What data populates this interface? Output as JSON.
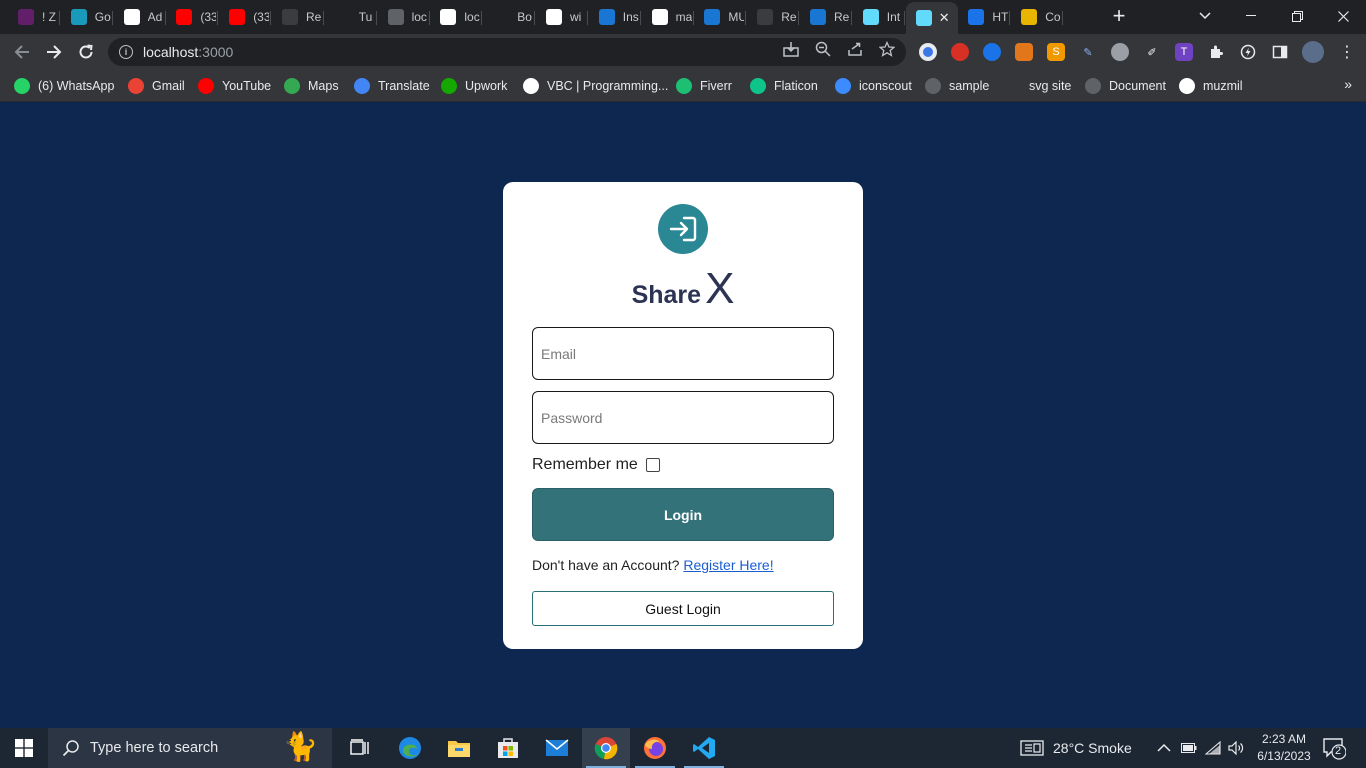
{
  "browser": {
    "tabs": [
      {
        "title": "! Z",
        "icon": "slack-icon",
        "color": "#611f69"
      },
      {
        "title": "Go",
        "icon": "go-icon",
        "color": "#1a9abb"
      },
      {
        "title": "Ad",
        "icon": "google-ads-icon",
        "color": "#ffffff"
      },
      {
        "title": "(33",
        "icon": "youtube-icon",
        "color": "#ff0000"
      },
      {
        "title": "(33",
        "icon": "youtube-icon",
        "color": "#ff0000"
      },
      {
        "title": "Re",
        "icon": "react-icon",
        "color": "#3a3c40"
      },
      {
        "title": "Tu",
        "icon": "dots-icon",
        "color": "#202124"
      },
      {
        "title": "loc",
        "icon": "react-icon",
        "color": "#5f6368"
      },
      {
        "title": "loc",
        "icon": "google-icon",
        "color": "#ffffff"
      },
      {
        "title": "Bo",
        "icon": "mdb-icon",
        "color": "#202124"
      },
      {
        "title": "wi",
        "icon": "github-icon",
        "color": "#ffffff"
      },
      {
        "title": "Ins",
        "icon": "mui-icon",
        "color": "#1976d2"
      },
      {
        "title": "ma",
        "icon": "github-icon",
        "color": "#ffffff"
      },
      {
        "title": "MU",
        "icon": "mui-icon",
        "color": "#1976d2"
      },
      {
        "title": "Re",
        "icon": "react-icon",
        "color": "#3a3c40"
      },
      {
        "title": "Re",
        "icon": "mui-icon",
        "color": "#1976d2"
      },
      {
        "title": "Int",
        "icon": "react-icon",
        "color": "#61dafb"
      },
      {
        "title": "",
        "icon": "react-icon",
        "color": "#61dafb"
      },
      {
        "title": "HT",
        "icon": "html-icon",
        "color": "#1a73e8"
      },
      {
        "title": "Co",
        "icon": "co-icon",
        "color": "#e8b600"
      }
    ],
    "url_host": "localhost",
    "url_port": ":3000",
    "bookmarks": [
      {
        "label": "(6) WhatsApp",
        "icon": "whatsapp-icon",
        "color": "#25d366"
      },
      {
        "label": "Gmail",
        "icon": "gmail-icon",
        "color": "#ea4335"
      },
      {
        "label": "YouTube",
        "icon": "youtube-icon",
        "color": "#ff0000"
      },
      {
        "label": "Maps",
        "icon": "maps-icon",
        "color": "#34a853"
      },
      {
        "label": "Translate",
        "icon": "translate-icon",
        "color": "#4285f4"
      },
      {
        "label": "Upwork",
        "icon": "upwork-icon",
        "color": "#14a800"
      },
      {
        "label": "VBC | Programming...",
        "icon": "vbc-icon",
        "color": "#ffffff"
      },
      {
        "label": "Fiverr",
        "icon": "fiverr-icon",
        "color": "#1dbf73"
      },
      {
        "label": "Flaticon",
        "icon": "flaticon-icon",
        "color": "#0fc489"
      },
      {
        "label": "iconscout",
        "icon": "iconscout-icon",
        "color": "#3c8bff"
      },
      {
        "label": "sample",
        "icon": "globe-icon",
        "color": "#5f6368"
      },
      {
        "label": "svg site",
        "icon": "svg-icon",
        "color": "#35363a"
      },
      {
        "label": "Document",
        "icon": "globe-icon",
        "color": "#5f6368"
      },
      {
        "label": "muzmil",
        "icon": "github-icon",
        "color": "#ffffff"
      }
    ]
  },
  "login": {
    "brand_word": "Share",
    "brand_letter": "X",
    "email_placeholder": "Email",
    "password_placeholder": "Password",
    "remember_label": "Remember me",
    "login_label": "Login",
    "register_prompt": "Don't have an Account?",
    "register_link": "Register Here!",
    "guest_label": "Guest Login"
  },
  "taskbar": {
    "search_placeholder": "Type here to search",
    "weather": "28°C  Smoke",
    "time": "2:23 AM",
    "date": "6/13/2023",
    "notification_count": "2"
  },
  "colors": {
    "page_bg": "#0e2750",
    "accent": "#2a8794",
    "login_button": "#34727a",
    "brand_text": "#2c3454",
    "link": "#1a5fd0"
  }
}
